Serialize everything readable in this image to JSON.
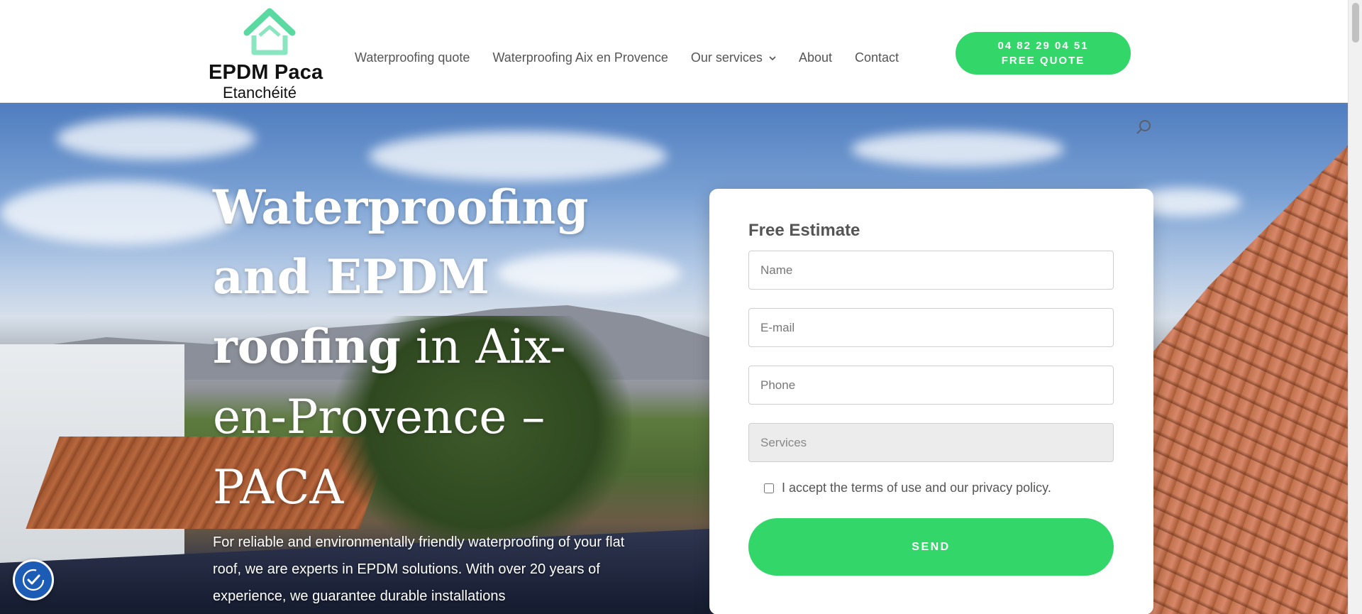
{
  "header": {
    "logo": {
      "line1": "EPDM Paca",
      "line2": "Etanchéité"
    },
    "nav": [
      {
        "label": "Waterproofing quote"
      },
      {
        "label": "Waterproofing Aix en Provence"
      },
      {
        "label": "Our services",
        "has_dropdown": true
      },
      {
        "label": "About"
      },
      {
        "label": "Contact"
      }
    ],
    "cta": {
      "phone": "04 82 29 04 51",
      "label": "FREE QUOTE"
    }
  },
  "hero": {
    "title_bold": "Waterproofing and EPDM roofing",
    "title_normal": " in Aix-en-Provence – PACA",
    "text": "For reliable and environmentally friendly waterproofing of your flat roof, we are experts in EPDM solutions. With over 20 years of experience, we guarantee durable installations"
  },
  "form": {
    "title": "Free Estimate",
    "name_placeholder": "Name",
    "email_placeholder": "E-mail",
    "phone_placeholder": "Phone",
    "services_placeholder": "Services",
    "consent_label": "I accept the terms of use and our privacy policy.",
    "send_label": "SEND"
  },
  "colors": {
    "accent": "#33d669",
    "logo_mark": "#5ad9a0",
    "badge": "#1d5cb5"
  },
  "icons": [
    "search-icon",
    "chevron-down-icon",
    "house-logo-icon",
    "accessibility-icon"
  ]
}
